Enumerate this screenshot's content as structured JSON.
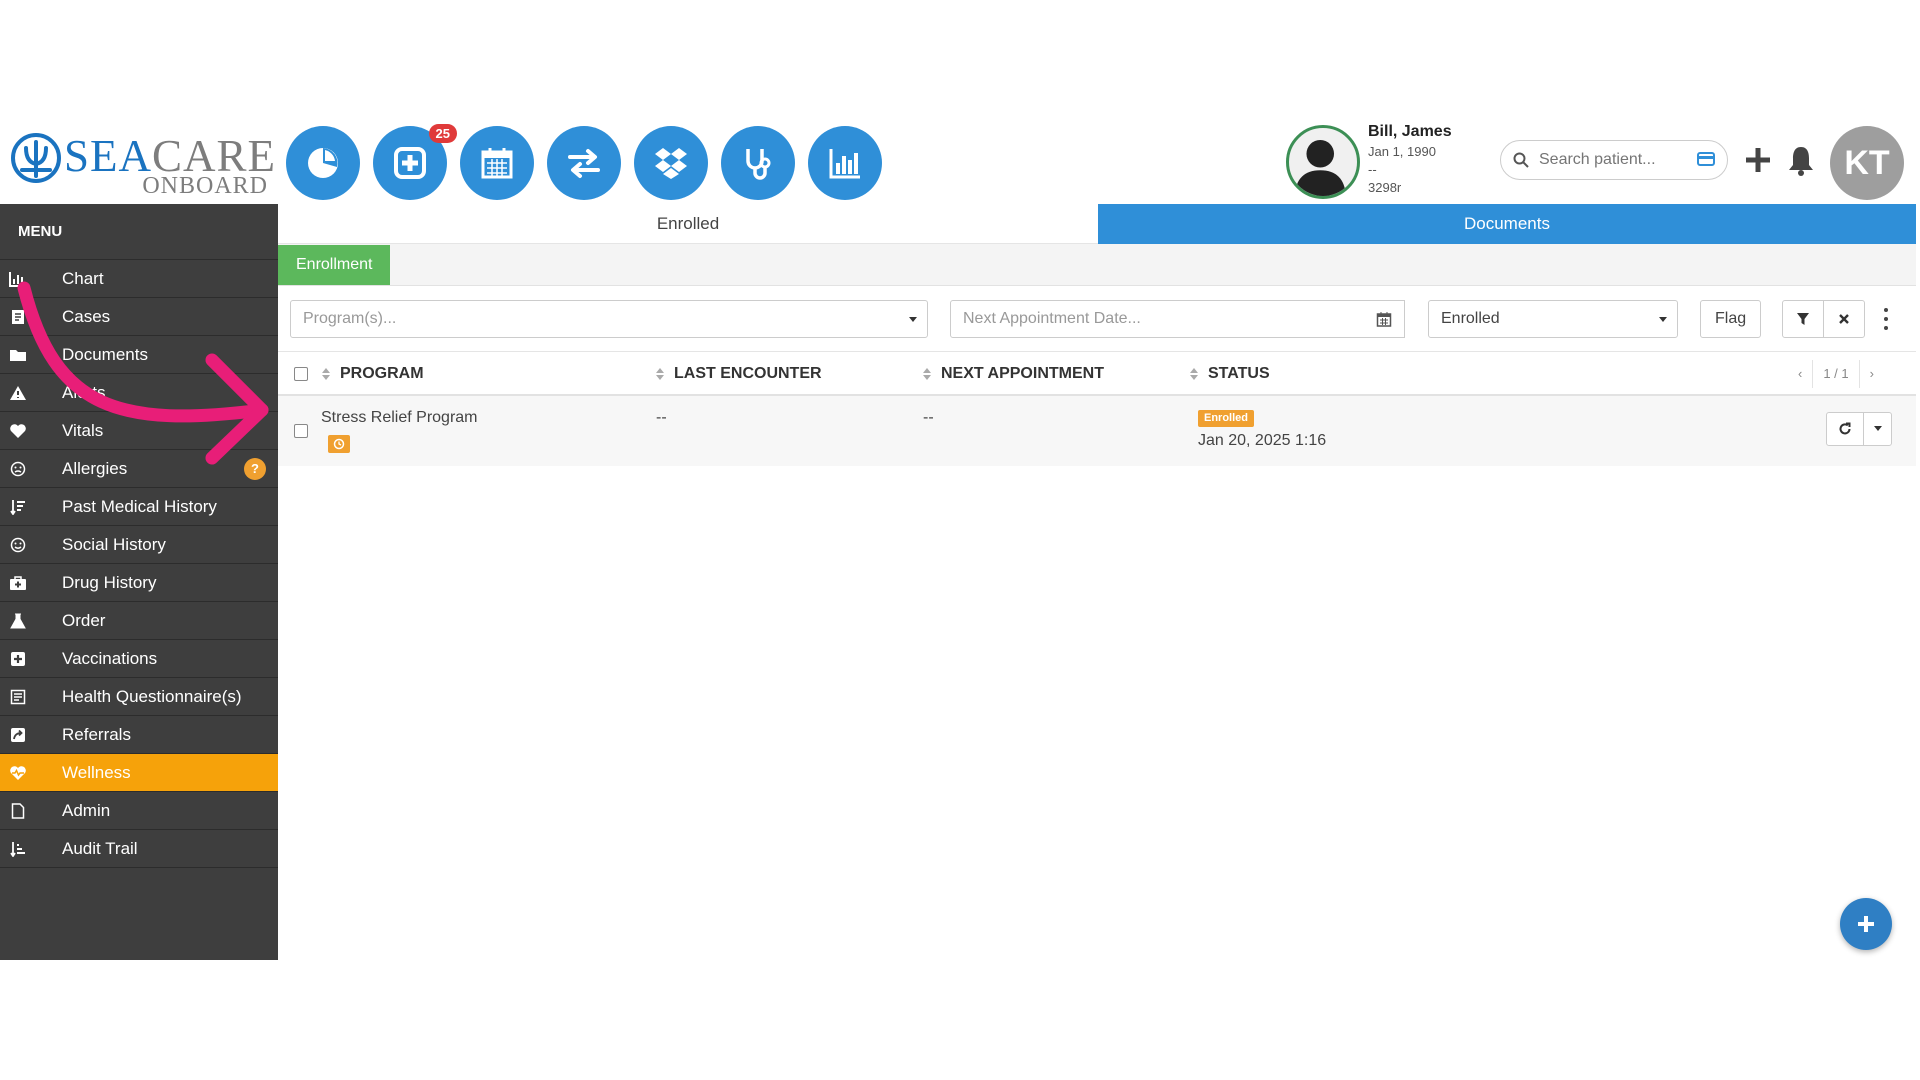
{
  "brand": {
    "main_a": "SEA",
    "main_b": "CARE",
    "sub": "ONBOARD"
  },
  "nav": {
    "badge_count": "25",
    "icons": [
      "pie-chart-icon",
      "medical-plus-icon",
      "calendar-icon",
      "exchange-icon",
      "dropbox-icon",
      "stethoscope-icon",
      "bar-chart-icon"
    ]
  },
  "patient": {
    "name": "Bill, James",
    "dob": "Jan 1, 1990",
    "line2": "--",
    "id": "3298r"
  },
  "search": {
    "placeholder": "Search patient..."
  },
  "user": {
    "initials": "KT"
  },
  "sidebar": {
    "title": "MENU",
    "items": [
      {
        "label": "Chart",
        "icon": "chart-icon"
      },
      {
        "label": "Cases",
        "icon": "cases-icon"
      },
      {
        "label": "Documents",
        "icon": "folder-icon"
      },
      {
        "label": "Alerts",
        "icon": "warning-icon"
      },
      {
        "label": "Vitals",
        "icon": "heart-icon"
      },
      {
        "label": "Allergies",
        "icon": "allergy-icon",
        "badge": "?"
      },
      {
        "label": "Past Medical History",
        "icon": "history-icon"
      },
      {
        "label": "Social History",
        "icon": "social-icon"
      },
      {
        "label": "Drug History",
        "icon": "medkit-icon"
      },
      {
        "label": "Order",
        "icon": "flask-icon"
      },
      {
        "label": "Vaccinations",
        "icon": "plus-square-icon"
      },
      {
        "label": "Health Questionnaire(s)",
        "icon": "questionnaire-icon"
      },
      {
        "label": "Referrals",
        "icon": "referral-icon"
      },
      {
        "label": "Wellness",
        "icon": "heartbeat-icon",
        "active": true
      },
      {
        "label": "Admin",
        "icon": "file-icon"
      },
      {
        "label": "Audit Trail",
        "icon": "sort-list-icon"
      }
    ]
  },
  "tabs": {
    "enrolled": "Enrolled",
    "documents": "Documents"
  },
  "subbar": {
    "enrollment_button": "Enrollment"
  },
  "filters": {
    "programs_placeholder": "Program(s)...",
    "appointment_placeholder": "Next Appointment Date...",
    "status_value": "Enrolled",
    "flag_label": "Flag"
  },
  "table": {
    "columns": [
      "PROGRAM",
      "LAST ENCOUNTER",
      "NEXT APPOINTMENT",
      "STATUS"
    ],
    "pager": {
      "prev": "‹",
      "page": "1 / 1",
      "next": "›"
    },
    "rows": [
      {
        "program": "Stress Relief Program",
        "last_encounter": "--",
        "next_appointment": "--",
        "status_badge": "Enrolled",
        "status_date": "Jan 20, 2025 1:16"
      }
    ]
  },
  "colors": {
    "primary": "#2f8fd8",
    "sidebar": "#3e3e3e",
    "active": "#f6a20a",
    "success": "#5cb85c",
    "badge": "#e03a3a",
    "annotation": "#e81e78"
  }
}
